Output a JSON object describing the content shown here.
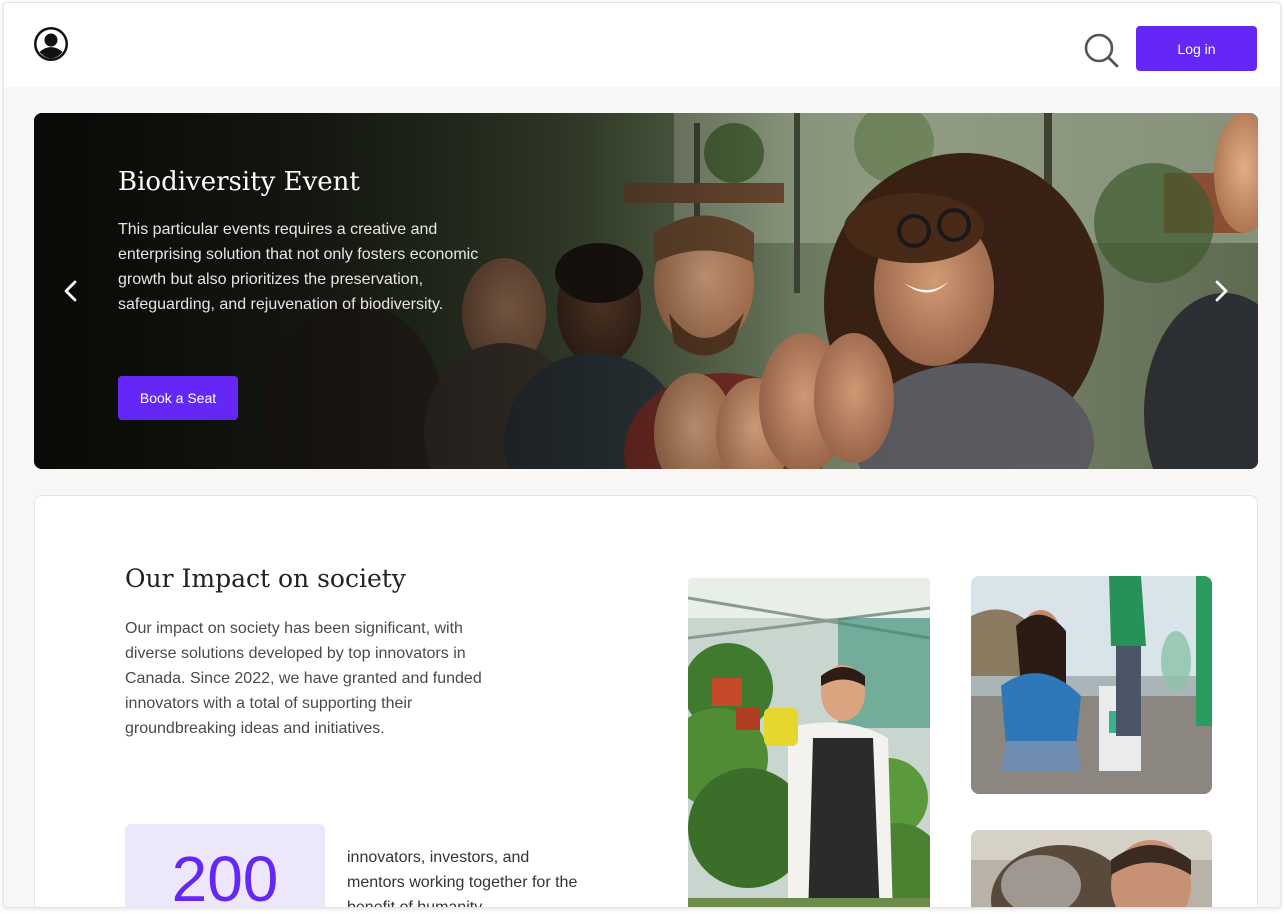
{
  "header": {
    "logo_icon": "user-circle-logo-icon",
    "search_icon": "search-icon",
    "login_label": "Log in"
  },
  "hero": {
    "title": "Biodiversity Event",
    "description": "This particular events requires a creative and enterprising solution that not only fosters economic growth but also prioritizes the preservation, safeguarding, and rejuvenation of biodiversity.",
    "button_label": "Book a Seat",
    "prev_icon": "chevron-left-icon",
    "next_icon": "chevron-right-icon",
    "image": "audience-clapping-photo"
  },
  "impact": {
    "title": "Our Impact on society",
    "description": "Our impact on society has been significant, with diverse solutions developed by top innovators in Canada. Since 2022, we have granted and funded innovators with a total of supporting their groundbreaking ideas and initiatives.",
    "stat_value": "200",
    "stat_text": "innovators, investors, and mentors working together for the benefit of humanity",
    "photos": [
      "greenhouse-gardener-photo",
      "beach-recycling-photo",
      "team-photo"
    ]
  },
  "colors": {
    "accent": "#6427f6",
    "stat_bg": "#ece7fb",
    "page_bg": "#f8f7f6"
  }
}
